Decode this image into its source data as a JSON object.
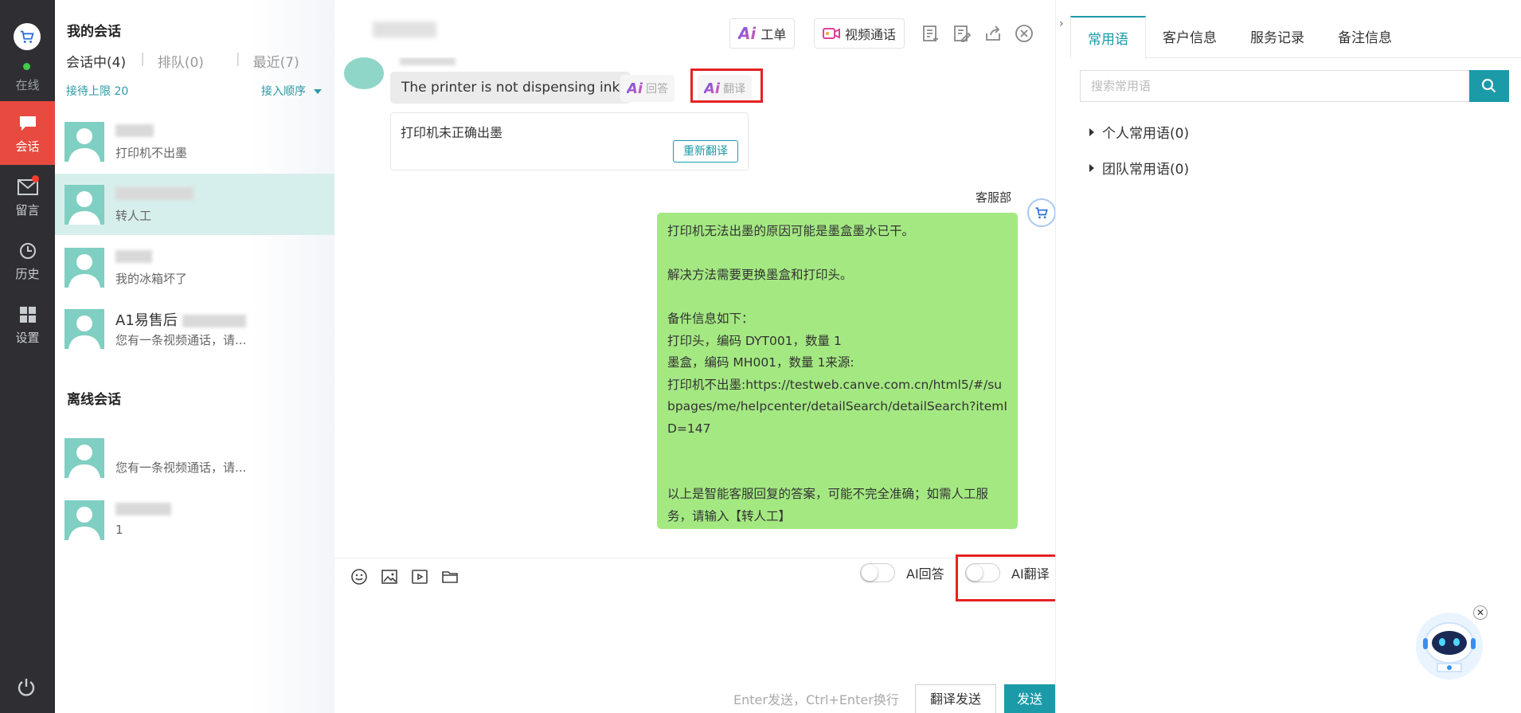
{
  "rail": {
    "online": "在线",
    "items": [
      {
        "label": "会话",
        "icon": "chat-icon"
      },
      {
        "label": "留言",
        "icon": "mail-icon"
      },
      {
        "label": "历史",
        "icon": "clock-icon"
      },
      {
        "label": "设置",
        "icon": "grid-icon"
      }
    ],
    "accent": "#e84a3f"
  },
  "conversations": {
    "title": "我的会话",
    "tabs": [
      {
        "label": "会话中(4)"
      },
      {
        "label": "排队(0)"
      },
      {
        "label": "最近(7)"
      }
    ],
    "limit": "接待上限 20",
    "order": "接入顺序",
    "items": [
      {
        "name": "",
        "msg": "打印机不出墨"
      },
      {
        "name": "",
        "msg": "转人工"
      },
      {
        "name": "",
        "msg": "我的冰箱坏了"
      },
      {
        "name": "A1易售后",
        "msg": "您有一条视频通话，请..."
      }
    ],
    "offline_title": "离线会话",
    "offline_items": [
      {
        "name": "",
        "msg": "您有一条视频通话，请..."
      },
      {
        "name": "",
        "msg": "1"
      }
    ]
  },
  "chat": {
    "toolbar": {
      "ticket": "工单",
      "video": "视频通话"
    },
    "customer_message": "The printer is not dispensing ink",
    "ai_reply_label": "回答",
    "ai_translate_label": "翻译",
    "translation": "打印机未正确出墨",
    "retranslate": "重新翻译",
    "agent_name": "客服部",
    "agent_reply_lines": [
      "打印机无法出墨的原因可能是墨盒墨水已干。",
      "",
      "解决方法需要更换墨盒和打印头。",
      "",
      "备件信息如下：",
      "打印头，编码 DYT001，数量 1",
      "墨盒，编码 MH001，数量 1来源:",
      "打印机不出墨:https://testweb.canve.com.cn/html5/#/subpages/me/helpcenter/detailSearch/detailSearch?itemID=147",
      "",
      "",
      "以上是智能客服回复的答案，可能不完全准确；如需人工服务，请输入【转人工】"
    ],
    "toggle_ai_reply": "AI回答",
    "toggle_ai_translate": "AI翻译",
    "hint": "Enter发送，Ctrl+Enter换行",
    "translate_send": "翻译发送",
    "send": "发送",
    "bubble_color": "#a4e882",
    "primary_color": "#1b9aa8"
  },
  "right_panel": {
    "tabs": [
      "常用语",
      "客户信息",
      "服务记录",
      "备注信息"
    ],
    "search_placeholder": "搜索常用语",
    "tree": [
      "个人常用语(0)",
      "团队常用语(0)"
    ]
  }
}
